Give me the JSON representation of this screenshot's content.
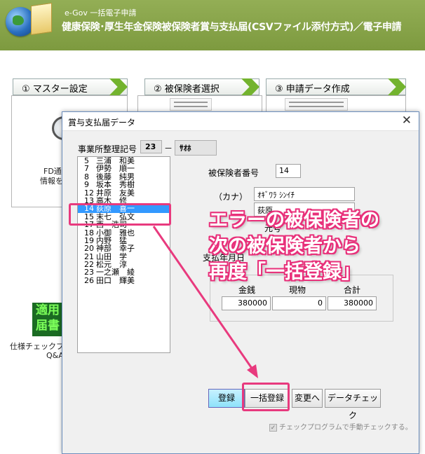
{
  "header": {
    "app_name": "e-Gov 一括電子申請",
    "title": "健康保険･厚生年金保険被保険者賞与支払届(CSVファイル添付方式)／電子申請"
  },
  "steps": [
    {
      "label": "① マスター設定"
    },
    {
      "label": "② 被保険者選択"
    },
    {
      "label": "③ 申請データ作成"
    }
  ],
  "background": {
    "panel1_text_line1": "FD通番、申",
    "panel1_text_line2": "情報を",
    "spec_icon_text": "適用届書",
    "spec_caption_line1": "仕様チェックプ",
    "spec_caption_line2": "Q&A"
  },
  "dialog": {
    "title": "賞与支払届データ",
    "close_glyph": "✕",
    "office_label": "事業所整理記号",
    "office_code": "23",
    "office_sep": "－",
    "office_name": "ｻｵﾎ",
    "list": [
      {
        "num": "5",
        "name": "三浦　和美"
      },
      {
        "num": "7",
        "name": "伊勢　順一"
      },
      {
        "num": "8",
        "name": "後藤　純男"
      },
      {
        "num": "9",
        "name": "坂本　秀樹"
      },
      {
        "num": "12",
        "name": "井原　友美"
      },
      {
        "num": "13",
        "name": "高木　修"
      },
      {
        "num": "14",
        "name": "荻原　喜一",
        "selected": true
      },
      {
        "num": "15",
        "name": "末七　弘文"
      },
      {
        "num": "17",
        "name": "西　浩司"
      },
      {
        "num": "18",
        "name": "小御　雅也"
      },
      {
        "num": "19",
        "name": "内野　猛"
      },
      {
        "num": "20",
        "name": "神部　幸子"
      },
      {
        "num": "21",
        "name": "山田　学"
      },
      {
        "num": "22",
        "name": "松元　淳"
      },
      {
        "num": "23",
        "name": "一之瀬　綾"
      },
      {
        "num": "26",
        "name": "田口　輝美"
      }
    ],
    "insured_no_label": "被保険者番号",
    "insured_no": "14",
    "kana_label": "（カナ）",
    "kana_value": "ｵｷﾞﾜﾗ ｼﾝｲﾁ",
    "name_value": "荻原　",
    "partial_label1": "元号",
    "partial_label2": "支払年月日",
    "amount": {
      "money_label": "金銭",
      "goods_label": "現物",
      "total_label": "合計",
      "money": "380000",
      "goods": "0",
      "total": "380000"
    },
    "buttons": {
      "register": "登録",
      "bulk_register": "一括登録",
      "change": "変更へ",
      "data_check": "データチェック"
    },
    "checkbox_label": "チェックプログラムで手動チェックする。",
    "checkbox_checked": true
  },
  "annotation": {
    "line1": "エラーの被保険者の",
    "line2": "次の被保険者から",
    "line3": "再度「一括登録」",
    "color": "#e83a7e"
  }
}
